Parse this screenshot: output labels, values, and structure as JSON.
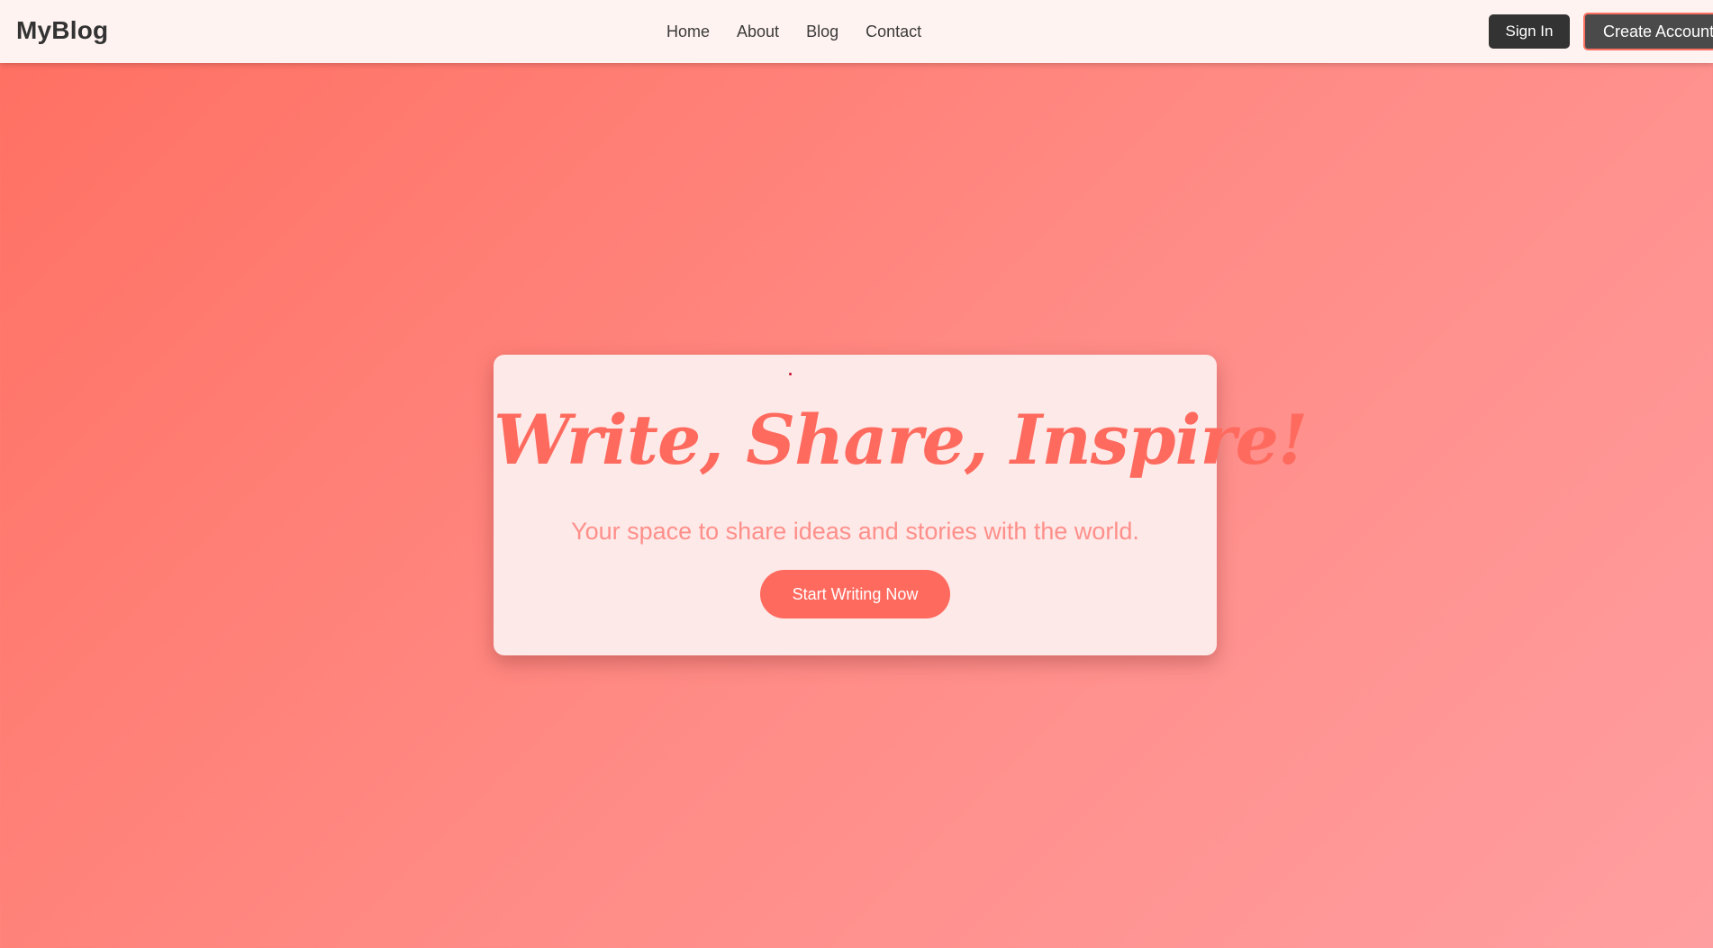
{
  "header": {
    "brand": "MyBlog",
    "nav": [
      "Home",
      "About",
      "Blog",
      "Contact"
    ],
    "sign_in_label": "Sign In",
    "create_account_label": "Create Account"
  },
  "hero": {
    "title": "Write, Share, Inspire!",
    "subtitle": "Your space to share ideas and stories with the world.",
    "cta_label": "Start Writing Now"
  },
  "colors": {
    "accent": "#ff6f61",
    "header_bg": "#fff3f1",
    "card_bg": "#fde9e8",
    "dark_button": "#333333"
  }
}
